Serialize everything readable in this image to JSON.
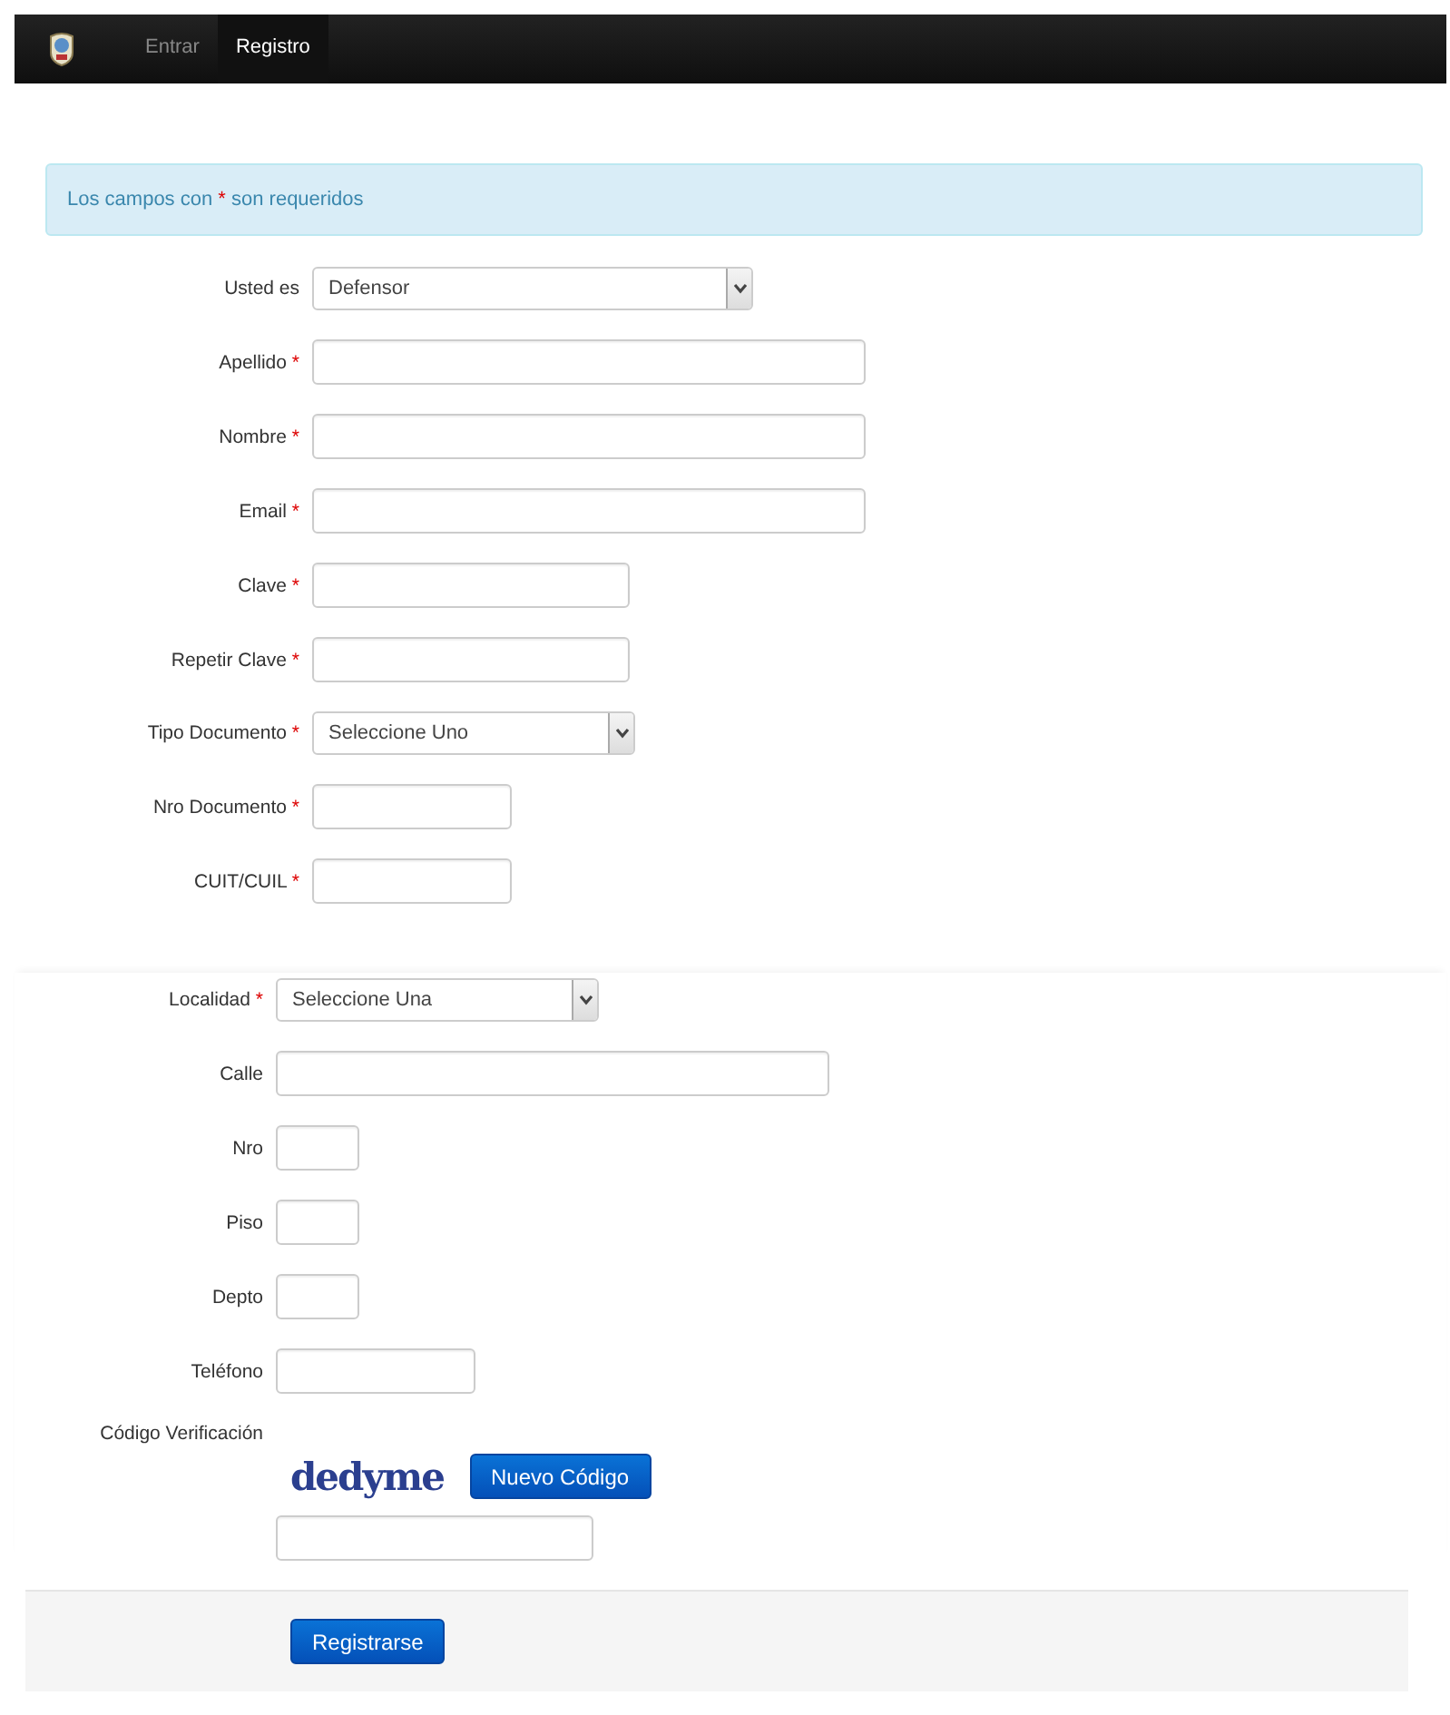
{
  "navbar": {
    "items": [
      {
        "label": "Entrar",
        "selected": false
      },
      {
        "label": "Registro",
        "selected": true
      }
    ]
  },
  "alert": {
    "parts": [
      "Los campos con ",
      "*",
      " son requeridos"
    ]
  },
  "sections": [
    {
      "fields": [
        {
          "label": "Usted es",
          "required": false,
          "kind": "select",
          "value": "Defensor"
        },
        {
          "label": "Apellido",
          "required": true,
          "kind": "text"
        },
        {
          "label": "Nombre",
          "required": true,
          "kind": "text"
        },
        {
          "label": "Email",
          "required": true,
          "kind": "text"
        },
        {
          "label": "Clave",
          "required": true,
          "kind": "password"
        },
        {
          "label": "Repetir Clave",
          "required": true,
          "kind": "password"
        },
        {
          "label": "Tipo Documento",
          "required": true,
          "kind": "select",
          "value": "Seleccione Uno"
        },
        {
          "label": "Nro Documento",
          "required": true,
          "kind": "text"
        },
        {
          "label": "CUIT/CUIL",
          "required": true,
          "kind": "text"
        }
      ]
    },
    {
      "fields": [
        {
          "label": "Localidad",
          "required": true,
          "kind": "select",
          "value": "Seleccione Una"
        },
        {
          "label": "Calle",
          "required": false,
          "kind": "text"
        },
        {
          "label": "Nro",
          "required": false,
          "kind": "text"
        },
        {
          "label": "Piso",
          "required": false,
          "kind": "text"
        },
        {
          "label": "Depto",
          "required": false,
          "kind": "text"
        },
        {
          "label": "Teléfono",
          "required": false,
          "kind": "text"
        },
        {
          "label": "Código Verificación",
          "required": false,
          "kind": "captcha",
          "captcha_text": "dedyme",
          "button": "Nuevo Código"
        }
      ]
    }
  ],
  "submit": "Registrarse"
}
